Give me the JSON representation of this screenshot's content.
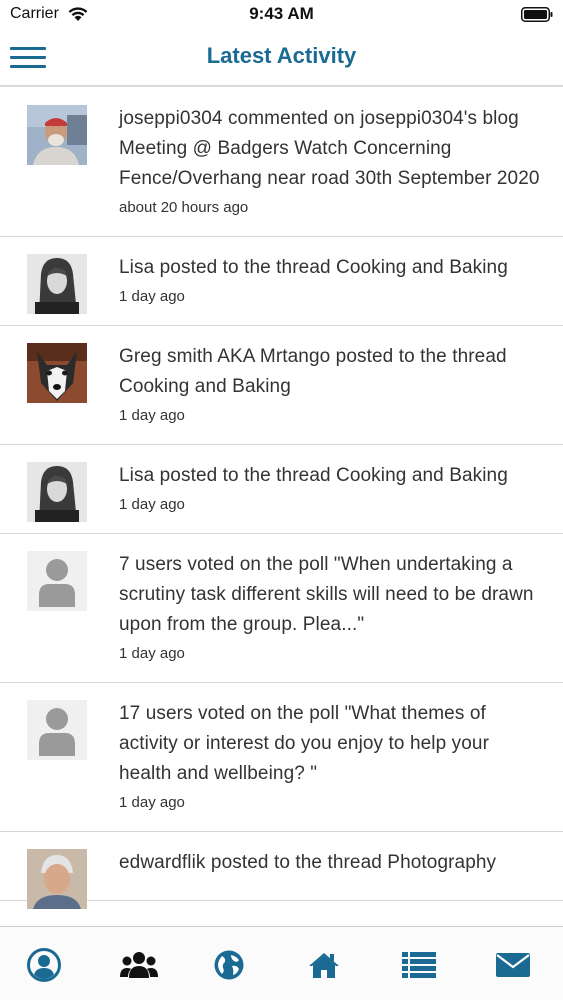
{
  "status_bar": {
    "carrier": "Carrier",
    "time": "9:43 AM"
  },
  "nav": {
    "title": "Latest Activity",
    "accent_color": "#1a6a93"
  },
  "feed": {
    "items": [
      {
        "avatar": "photo-man-red-cap",
        "text": "joseppi0304 commented on joseppi0304's blog Meeting @ Badgers Watch Concerning Fence/Overhang near road 30th September 2020",
        "time": "about 20 hours ago"
      },
      {
        "avatar": "photo-woman-bw",
        "text": "Lisa posted to the thread Cooking and Baking",
        "time": "1 day ago"
      },
      {
        "avatar": "photo-husky-dog",
        "text": "Greg smith AKA Mrtango posted to the thread Cooking and Baking",
        "time": "1 day ago"
      },
      {
        "avatar": "photo-woman-bw",
        "text": "Lisa posted to the thread Cooking and Baking",
        "time": "1 day ago"
      },
      {
        "avatar": "default-user-silhouette",
        "text": "7 users voted on the poll \"When undertaking a scrutiny task different skills will need to be drawn upon from the group. Plea...\"",
        "time": "1 day ago"
      },
      {
        "avatar": "default-user-silhouette",
        "text": "17 users voted on the poll \"What themes of activity or interest do you enjoy to help your health and wellbeing? \"",
        "time": "1 day ago"
      },
      {
        "avatar": "photo-man-grey-hair",
        "text": "edwardflik posted to the thread Photography",
        "time": ""
      }
    ]
  },
  "tab_bar": {
    "icons": [
      "profile-icon",
      "group-icon",
      "globe-icon",
      "home-icon",
      "list-icon",
      "mail-icon"
    ]
  }
}
